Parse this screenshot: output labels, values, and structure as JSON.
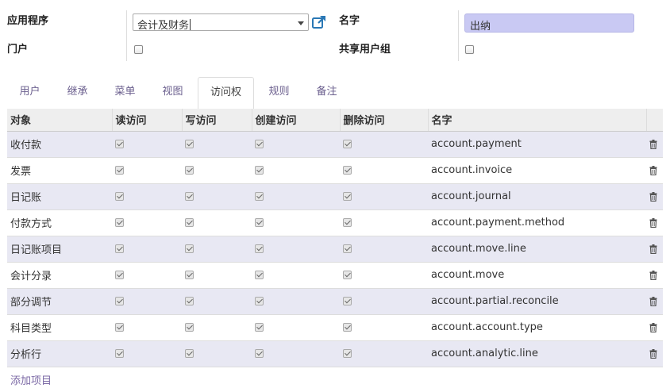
{
  "form": {
    "application_label": "应用程序",
    "application_value": "会计及财务",
    "portal_label": "门户",
    "name_label": "名字",
    "name_value": "出纳",
    "shared_label": "共享用户组"
  },
  "tabs": [
    {
      "label": "用户",
      "active": false
    },
    {
      "label": "继承",
      "active": false
    },
    {
      "label": "菜单",
      "active": false
    },
    {
      "label": "视图",
      "active": false
    },
    {
      "label": "访问权",
      "active": true
    },
    {
      "label": "规则",
      "active": false
    },
    {
      "label": "备注",
      "active": false
    }
  ],
  "table": {
    "headers": [
      "对象",
      "读访问",
      "写访问",
      "创建访问",
      "删除访问",
      "名字"
    ],
    "rows": [
      {
        "object": "收付款",
        "read": true,
        "write": true,
        "create": true,
        "unlink": true,
        "name": "account.payment"
      },
      {
        "object": "发票",
        "read": true,
        "write": true,
        "create": true,
        "unlink": true,
        "name": "account.invoice"
      },
      {
        "object": "日记账",
        "read": true,
        "write": true,
        "create": true,
        "unlink": true,
        "name": "account.journal"
      },
      {
        "object": "付款方式",
        "read": true,
        "write": true,
        "create": true,
        "unlink": true,
        "name": "account.payment.method"
      },
      {
        "object": "日记账项目",
        "read": true,
        "write": true,
        "create": true,
        "unlink": true,
        "name": "account.move.line"
      },
      {
        "object": "会计分录",
        "read": true,
        "write": true,
        "create": true,
        "unlink": true,
        "name": "account.move"
      },
      {
        "object": "部分调节",
        "read": true,
        "write": true,
        "create": true,
        "unlink": true,
        "name": "account.partial.reconcile"
      },
      {
        "object": "科目类型",
        "read": true,
        "write": true,
        "create": true,
        "unlink": true,
        "name": "account.account.type"
      },
      {
        "object": "分析行",
        "read": true,
        "write": true,
        "create": true,
        "unlink": true,
        "name": "account.analytic.line"
      }
    ],
    "add_item_label": "添加项目"
  },
  "colors": {
    "row_stripe": "#e8e8f3",
    "name_input_bg": "#c9c9f3",
    "link": "#7c6aa6",
    "external_link_icon": "#2a78b5"
  }
}
